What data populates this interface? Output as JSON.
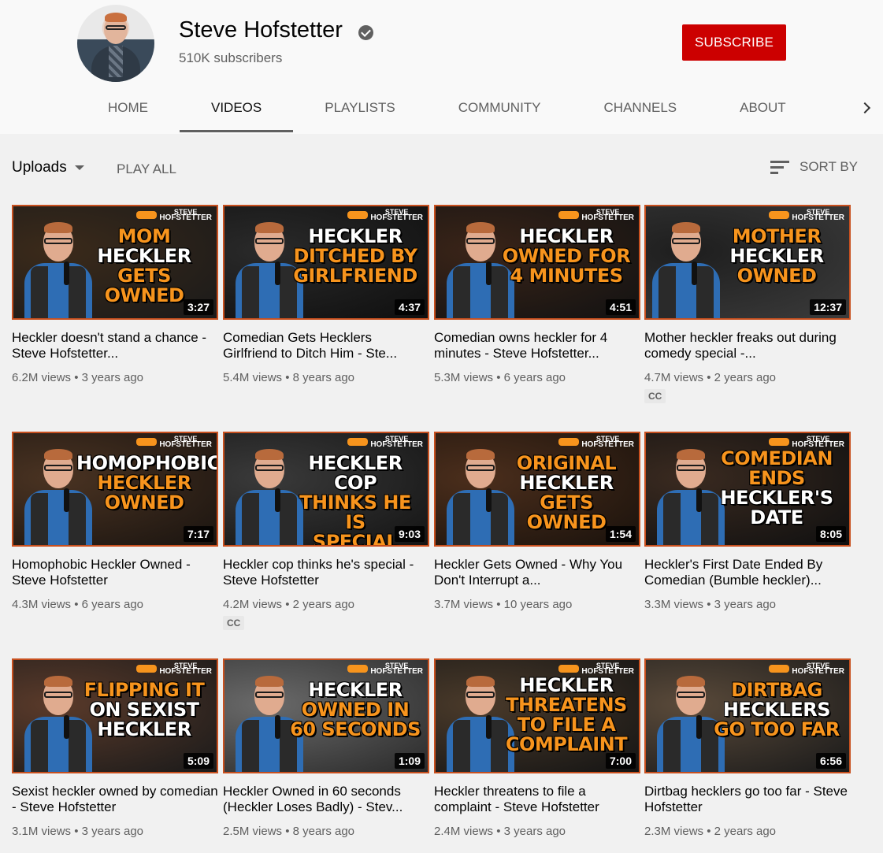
{
  "channel": {
    "name": "Steve Hofstetter",
    "subscribers": "510K subscribers",
    "subscribe_label": "SUBSCRIBE"
  },
  "tabs": [
    {
      "label": "HOME",
      "active": false
    },
    {
      "label": "VIDEOS",
      "active": true
    },
    {
      "label": "PLAYLISTS",
      "active": false
    },
    {
      "label": "COMMUNITY",
      "active": false
    },
    {
      "label": "CHANNELS",
      "active": false
    },
    {
      "label": "ABOUT",
      "active": false
    }
  ],
  "toolbar": {
    "uploads_label": "Uploads",
    "play_all_label": "PLAY ALL",
    "sort_label": "SORT BY"
  },
  "thumb_brand": {
    "line1": "STEVE",
    "line2": "HOFSTETTER"
  },
  "videos": [
    {
      "title": "Heckler doesn't stand a chance - Steve Hofstetter...",
      "views": "6.2M views",
      "age": "3 years ago",
      "duration": "3:27",
      "cc": false,
      "thumb_lines": [
        {
          "text": "MOM",
          "color": "o"
        },
        {
          "text": "HECKLER",
          "color": "w"
        },
        {
          "text": "GETS OWNED",
          "color": "o"
        }
      ]
    },
    {
      "title": "Comedian Gets Hecklers Girlfriend to Ditch Him - Ste...",
      "views": "5.4M views",
      "age": "8 years ago",
      "duration": "4:37",
      "cc": false,
      "thumb_lines": [
        {
          "text": "HECKLER",
          "color": "w"
        },
        {
          "text": "DITCHED BY",
          "color": "o"
        },
        {
          "text": "GIRLFRIEND",
          "color": "o"
        }
      ]
    },
    {
      "title": "Comedian owns heckler for 4 minutes - Steve Hofstetter...",
      "views": "5.3M views",
      "age": "6 years ago",
      "duration": "4:51",
      "cc": false,
      "thumb_lines": [
        {
          "text": "HECKLER",
          "color": "w"
        },
        {
          "text": "OWNED FOR",
          "color": "o"
        },
        {
          "text": "4 MINUTES",
          "color": "o"
        }
      ]
    },
    {
      "title": "Mother heckler freaks out during comedy special -...",
      "views": "4.7M views",
      "age": "2 years ago",
      "duration": "12:37",
      "cc": true,
      "thumb_lines": [
        {
          "text": "MOTHER",
          "color": "o"
        },
        {
          "text": "HECKLER",
          "color": "w"
        },
        {
          "text": "OWNED",
          "color": "o"
        }
      ]
    },
    {
      "title": "Homophobic Heckler Owned - Steve Hofstetter",
      "views": "4.3M views",
      "age": "6 years ago",
      "duration": "7:17",
      "cc": false,
      "thumb_lines": [
        {
          "text": "HOMOPHOBIC",
          "color": "w"
        },
        {
          "text": "HECKLER",
          "color": "o"
        },
        {
          "text": "OWNED",
          "color": "o"
        }
      ]
    },
    {
      "title": "Heckler cop thinks he's special - Steve Hofstetter",
      "views": "4.2M views",
      "age": "2 years ago",
      "duration": "9:03",
      "cc": true,
      "thumb_lines": [
        {
          "text": "HECKLER COP",
          "color": "w"
        },
        {
          "text": "THINKS HE IS",
          "color": "o"
        },
        {
          "text": "SPECIAL",
          "color": "o"
        }
      ]
    },
    {
      "title": "Heckler Gets Owned - Why You Don't Interrupt a...",
      "views": "3.7M views",
      "age": "10 years ago",
      "duration": "1:54",
      "cc": false,
      "thumb_lines": [
        {
          "text": "ORIGINAL",
          "color": "o"
        },
        {
          "text": "HECKLER",
          "color": "w"
        },
        {
          "text": "GETS OWNED",
          "color": "o"
        }
      ]
    },
    {
      "title": "Heckler's First Date Ended By Comedian (Bumble heckler)...",
      "views": "3.3M views",
      "age": "3 years ago",
      "duration": "8:05",
      "cc": false,
      "thumb_lines": [
        {
          "text": "COMEDIAN",
          "color": "o"
        },
        {
          "text": "ENDS",
          "color": "o"
        },
        {
          "text": "HECKLER'S",
          "color": "w"
        },
        {
          "text": "DATE",
          "color": "w"
        }
      ]
    },
    {
      "title": "Sexist heckler owned by comedian - Steve Hofstetter",
      "views": "3.1M views",
      "age": "3 years ago",
      "duration": "5:09",
      "cc": false,
      "thumb_lines": [
        {
          "text": "FLIPPING IT",
          "color": "o"
        },
        {
          "text": "ON SEXIST",
          "color": "w"
        },
        {
          "text": "HECKLER",
          "color": "w"
        }
      ]
    },
    {
      "title": "Heckler Owned in 60 seconds (Heckler Loses Badly) - Stev...",
      "views": "2.5M views",
      "age": "8 years ago",
      "duration": "1:09",
      "cc": false,
      "thumb_lines": [
        {
          "text": "HECKLER",
          "color": "w"
        },
        {
          "text": "OWNED IN",
          "color": "o"
        },
        {
          "text": "60 SECONDS",
          "color": "o"
        }
      ]
    },
    {
      "title": "Heckler threatens to file a complaint - Steve Hofstetter",
      "views": "2.4M views",
      "age": "3 years ago",
      "duration": "7:00",
      "cc": false,
      "thumb_lines": [
        {
          "text": "HECKLER",
          "color": "w"
        },
        {
          "text": "THREATENS",
          "color": "o"
        },
        {
          "text": "TO FILE A",
          "color": "o"
        },
        {
          "text": "COMPLAINT",
          "color": "o"
        }
      ]
    },
    {
      "title": "Dirtbag hecklers go too far - Steve Hofstetter",
      "views": "2.3M views",
      "age": "2 years ago",
      "duration": "6:56",
      "cc": false,
      "thumb_lines": [
        {
          "text": "DIRTBAG",
          "color": "o"
        },
        {
          "text": "HECKLERS",
          "color": "w"
        },
        {
          "text": "GO TOO FAR",
          "color": "o"
        }
      ]
    }
  ],
  "cc_label": "CC",
  "meta_separator": "•",
  "colors": {
    "accent": "#cc0000",
    "thumb_orange": "#f7941d",
    "thumb_border": "#c8501f",
    "meta_gray": "#606060"
  }
}
